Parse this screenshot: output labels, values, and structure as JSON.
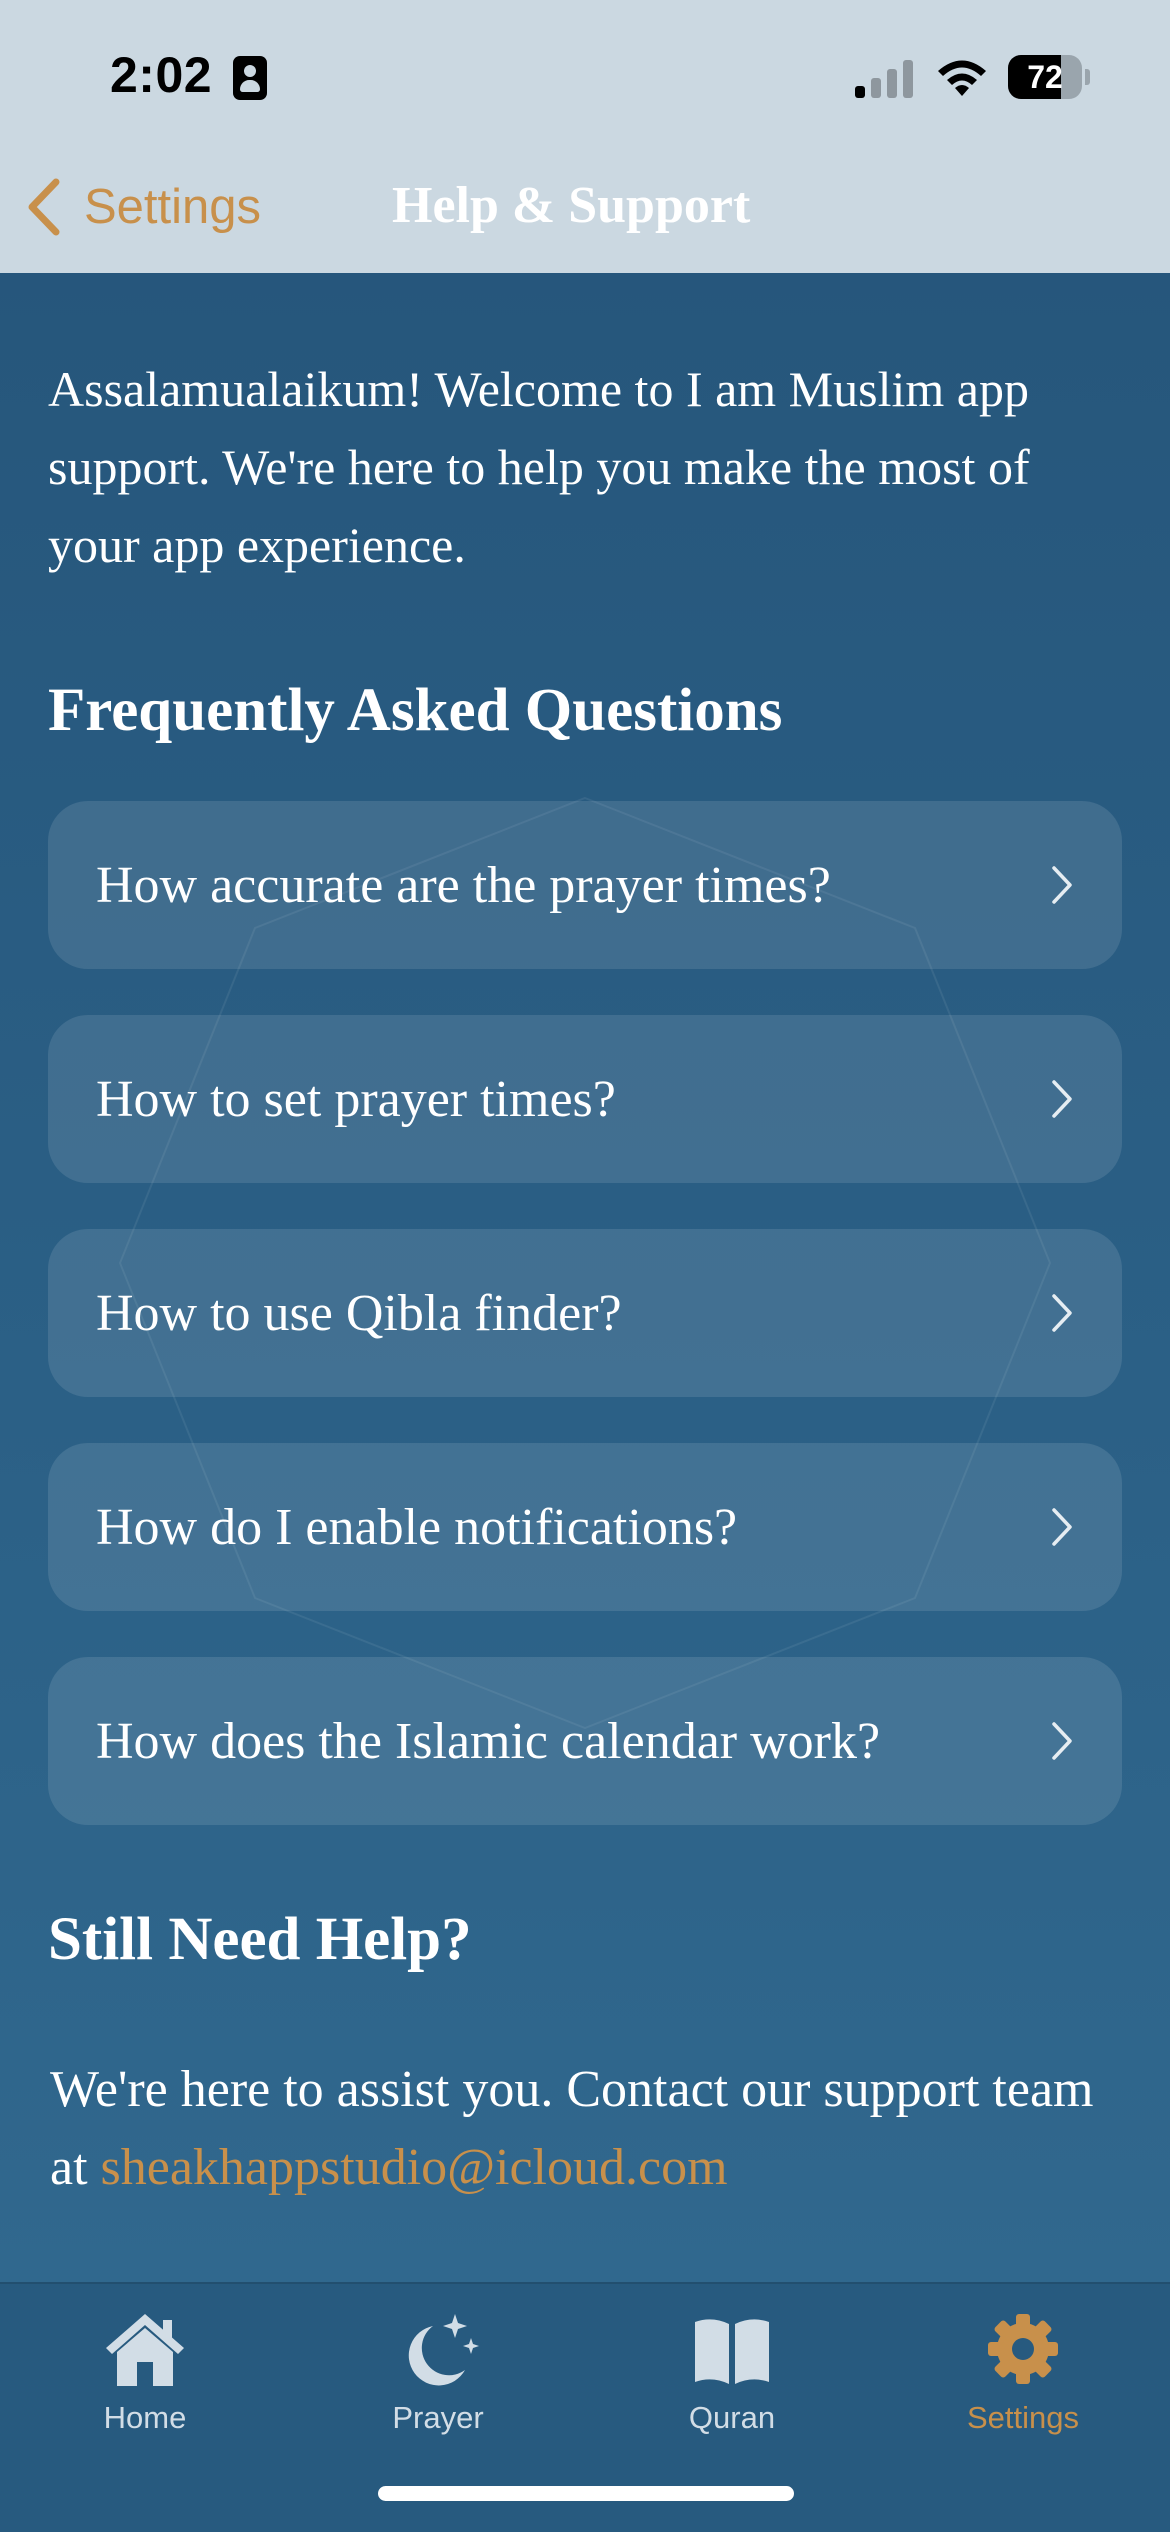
{
  "status_bar": {
    "time": "2:02",
    "battery": "72",
    "battery_level": 0.72
  },
  "nav": {
    "back_label": "Settings",
    "title": "Help & Support"
  },
  "intro_text": "Assalamualaikum! Welcome to I am Muslim app support. We're here to help you make the most of your app experience.",
  "faq": {
    "heading": "Frequently Asked Questions",
    "items": [
      "How accurate are the prayer times?",
      "How to set prayer times?",
      "How to use Qibla finder?",
      "How do I enable notifications?",
      "How does the Islamic calendar work?"
    ]
  },
  "help": {
    "heading": "Still Need Help?",
    "text": "We're here to assist you. Contact our support team at ",
    "email": "sheakhappstudio@icloud.com"
  },
  "tabs": [
    {
      "label": "Home",
      "icon": "house-icon",
      "active": false
    },
    {
      "label": "Prayer",
      "icon": "moon-stars-icon",
      "active": false
    },
    {
      "label": "Quran",
      "icon": "book-icon",
      "active": false
    },
    {
      "label": "Settings",
      "icon": "gear-icon",
      "active": true
    }
  ],
  "colors": {
    "accent": "#c8904b",
    "background_top": "#255479",
    "background_bottom": "#326a90",
    "header": "#cbd8e1"
  }
}
